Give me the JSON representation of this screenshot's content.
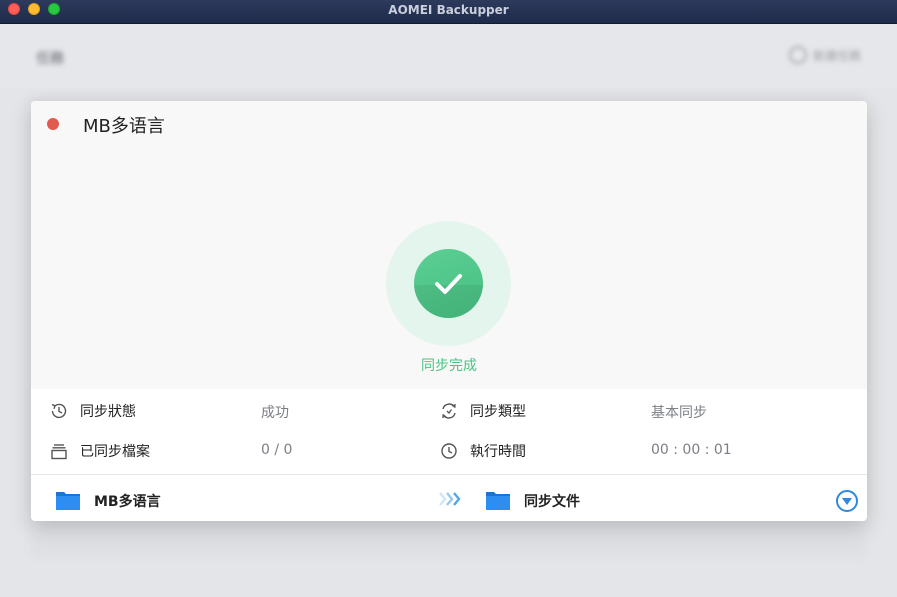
{
  "window": {
    "title": "AOMEI Backupper"
  },
  "background": {
    "title": "任務",
    "action_label": "新建任務"
  },
  "dialog": {
    "title": "MB多语言",
    "status_text": "同步完成",
    "info": [
      {
        "label": "同步狀態",
        "value": "成功",
        "icon": "status-clock-icon"
      },
      {
        "label": "同步類型",
        "value": "基本同步",
        "icon": "sync-type-icon"
      },
      {
        "label": "已同步檔案",
        "value": "0 / 0",
        "icon": "files-stack-icon"
      },
      {
        "label": "執行時間",
        "value": "00 : 00 : 01",
        "icon": "clock-icon"
      }
    ],
    "source": {
      "label": "MB多语言",
      "icon": "folder-icon"
    },
    "destination": {
      "label": "同步文件",
      "icon": "folder-icon"
    }
  },
  "colors": {
    "success": "#4cc384",
    "accent": "#2d89e0",
    "close_dot": "#e05a4e"
  }
}
